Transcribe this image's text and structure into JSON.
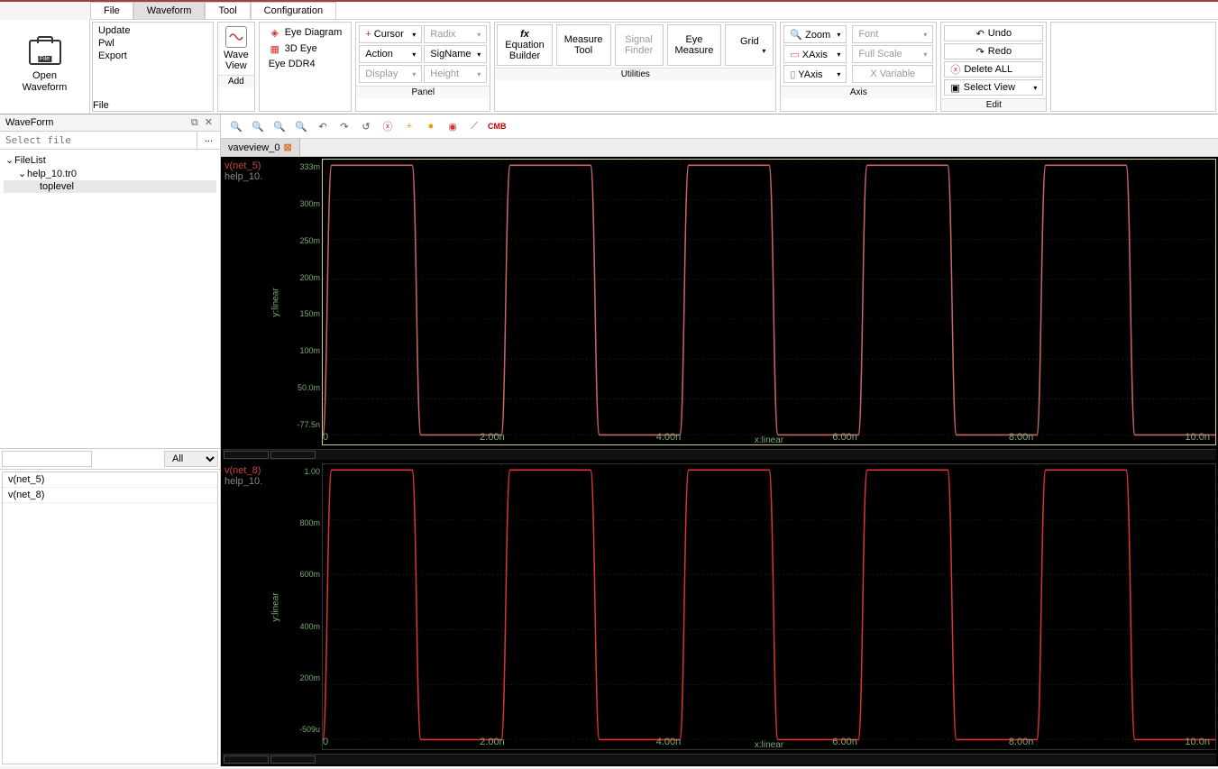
{
  "menu": {
    "tabs": [
      "File",
      "Waveform",
      "Tool",
      "Configuration"
    ],
    "active": 1
  },
  "open_waveform": {
    "line1": "Open",
    "line2": "Waveform"
  },
  "file_group": {
    "items": [
      "Update",
      "Pwl",
      "Export"
    ],
    "footer": "File"
  },
  "add_group": {
    "line1": "Wave",
    "line2": "View",
    "footer": "Add"
  },
  "eye_group": {
    "items": [
      "Eye Diagram",
      "3D Eye",
      "Eye DDR4"
    ]
  },
  "panel_group": {
    "footer": "Panel",
    "row1": [
      {
        "label": "Cursor",
        "icon": "+",
        "en": true
      },
      {
        "label": "Radix",
        "en": false
      }
    ],
    "row2": [
      {
        "label": "Action",
        "en": true
      },
      {
        "label": "SigName",
        "en": true
      }
    ],
    "row3": [
      {
        "label": "Display",
        "en": false
      },
      {
        "label": "Height",
        "en": false
      }
    ]
  },
  "utilities": {
    "footer": "Utilities",
    "items": [
      {
        "l1": "fx",
        "l2": "Equation",
        "l3": "Builder",
        "en": true,
        "fx": true
      },
      {
        "l1": "",
        "l2": "Measure",
        "l3": "Tool",
        "en": true
      },
      {
        "l1": "",
        "l2": "Signal",
        "l3": "Finder",
        "en": false
      },
      {
        "l1": "",
        "l2": "Eye",
        "l3": "Measure",
        "en": true
      },
      {
        "l1": "",
        "l2": "Grid",
        "l3": "",
        "en": true,
        "caret": true
      }
    ]
  },
  "axis_group": {
    "footer": "Axis",
    "left": [
      {
        "label": "Zoom",
        "icon": "🔍"
      },
      {
        "label": "XAxis",
        "icon": "▭"
      },
      {
        "label": "YAxis",
        "icon": "▯"
      }
    ],
    "right": [
      {
        "label": "Font",
        "en": false
      },
      {
        "label": "Full Scale",
        "en": false
      },
      {
        "label": "X Variable",
        "en": false
      }
    ]
  },
  "edit_group": {
    "footer": "Edit",
    "items": [
      {
        "label": "Undo",
        "icon": "↶"
      },
      {
        "label": "Redo",
        "icon": "↷"
      },
      {
        "label": "Delete ALL",
        "icon": "ⓧ",
        "red": true
      },
      {
        "label": "Select View",
        "icon": "▣",
        "caret": true
      }
    ]
  },
  "sidebar": {
    "title": "WaveForm",
    "select_placeholder": "Select file",
    "browse": "...",
    "tree": {
      "root": "FileList",
      "child": "help_10.tr0",
      "leaf": "toplevel"
    },
    "filter_all": "All",
    "signals": [
      "v(net_5)",
      "v(net_8)"
    ]
  },
  "wave_toolbar": {
    "cmb": "CMB"
  },
  "wave_tab": "vaveview_0",
  "chart_data": [
    {
      "type": "line",
      "signal": "v(net_5)",
      "file": "help_10.",
      "ylabel": "y:linear",
      "xlabel": "x:linear",
      "yticks": [
        "333m",
        "300m",
        "250m",
        "200m",
        "150m",
        "100m",
        "50.0m",
        "-77.5n"
      ],
      "xticks": [
        "0",
        "2.00n",
        "4.00n",
        "6.00n",
        "8.00n",
        "10.0n"
      ],
      "ylim": [
        -7.75e-08,
        0.333
      ],
      "xlim": [
        0,
        1e-08
      ],
      "period_ns": 2.0,
      "amplitude": 0.333,
      "selected": true,
      "color": "#cc6666"
    },
    {
      "type": "line",
      "signal": "v(net_8)",
      "file": "help_10.",
      "ylabel": "y:linear",
      "xlabel": "x:linear",
      "yticks": [
        "1.00",
        "800m",
        "600m",
        "400m",
        "200m",
        "-509u"
      ],
      "xticks": [
        "0",
        "2.00n",
        "4.00n",
        "6.00n",
        "8.00n",
        "10.0n"
      ],
      "ylim": [
        -0.000509,
        1.0
      ],
      "xlim": [
        0,
        1e-08
      ],
      "period_ns": 2.0,
      "amplitude": 1.0,
      "selected": false,
      "color": "#dd3333"
    }
  ]
}
